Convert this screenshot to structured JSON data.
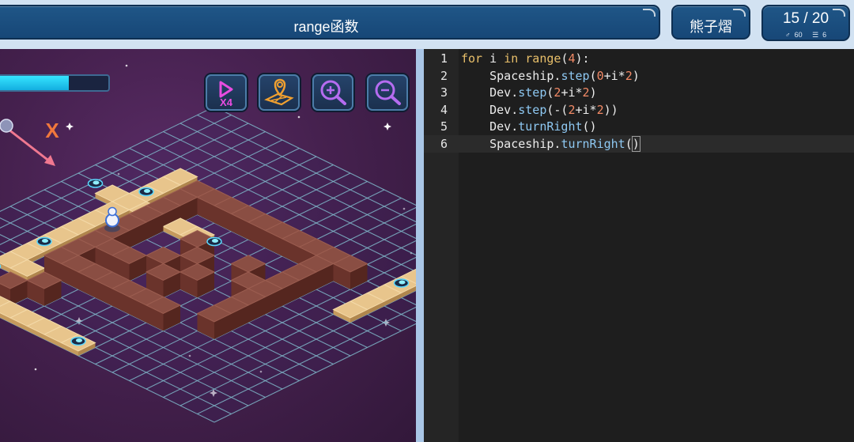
{
  "header": {
    "title": "range函数",
    "user": "熊子熠",
    "level": "15 / 20",
    "stat_a_icon": "person-icon",
    "stat_a": "60",
    "stat_b_icon": "list-icon",
    "stat_b": "6"
  },
  "game": {
    "progress": 0.64,
    "target_marker": "X",
    "tools": [
      {
        "icon": "play-x4-icon",
        "label": "X4"
      },
      {
        "icon": "map-pin-icon"
      },
      {
        "icon": "zoom-in-icon"
      },
      {
        "icon": "zoom-out-icon"
      }
    ],
    "colors": {
      "space_bg": "#46214f",
      "grid_line": "#7fb7c9",
      "path_tile": "#e8c58c",
      "wall_block": "#8a4e43",
      "progress_fill": "#36e4ff",
      "tool_glow_pink": "#e84ce0",
      "tool_glow_orange": "#f0a030"
    }
  },
  "editor": {
    "lines": [
      [
        {
          "t": "for",
          "c": "kw"
        },
        {
          "t": " i ",
          "c": ""
        },
        {
          "t": "in",
          "c": "kw"
        },
        {
          "t": " ",
          "c": ""
        },
        {
          "t": "range",
          "c": "kw"
        },
        {
          "t": "(",
          "c": ""
        },
        {
          "t": "4",
          "c": "num"
        },
        {
          "t": "):",
          "c": ""
        }
      ],
      [
        {
          "t": "    Spaceship.",
          "c": ""
        },
        {
          "t": "step",
          "c": "fn"
        },
        {
          "t": "(",
          "c": ""
        },
        {
          "t": "0",
          "c": "num"
        },
        {
          "t": "+i*",
          "c": ""
        },
        {
          "t": "2",
          "c": "num"
        },
        {
          "t": ")",
          "c": ""
        }
      ],
      [
        {
          "t": "    Dev.",
          "c": ""
        },
        {
          "t": "step",
          "c": "fn"
        },
        {
          "t": "(",
          "c": ""
        },
        {
          "t": "2",
          "c": "num"
        },
        {
          "t": "+i*",
          "c": ""
        },
        {
          "t": "2",
          "c": "num"
        },
        {
          "t": ")",
          "c": ""
        }
      ],
      [
        {
          "t": "    Dev.",
          "c": ""
        },
        {
          "t": "step",
          "c": "fn"
        },
        {
          "t": "(-(",
          "c": ""
        },
        {
          "t": "2",
          "c": "num"
        },
        {
          "t": "+i*",
          "c": ""
        },
        {
          "t": "2",
          "c": "num"
        },
        {
          "t": "))",
          "c": ""
        }
      ],
      [
        {
          "t": "    Dev.",
          "c": ""
        },
        {
          "t": "turnRight",
          "c": "fn"
        },
        {
          "t": "()",
          "c": ""
        }
      ],
      [
        {
          "t": "    Spaceship.",
          "c": ""
        },
        {
          "t": "turnRight",
          "c": "fn"
        },
        {
          "t": "(",
          "c": ""
        },
        {
          "t": ")",
          "c": "brk"
        }
      ]
    ],
    "line_numbers": [
      "1",
      "2",
      "3",
      "4",
      "5",
      "6"
    ],
    "active_line": 6
  }
}
